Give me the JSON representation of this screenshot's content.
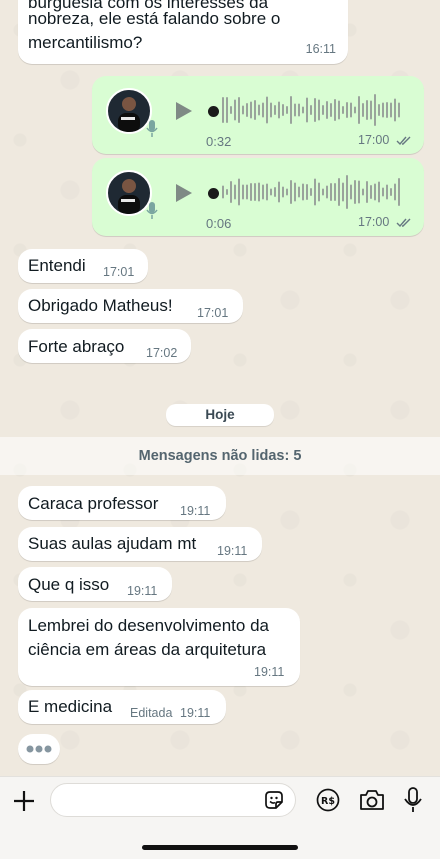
{
  "messages": {
    "m0_line1": "burguesia com os interesses da",
    "m0_line2": "nobreza, ele está falando sobre o",
    "m0_line3": "mercantilismo?",
    "m0_time": "16:11",
    "v1_duration": "0:32",
    "v1_time": "17:00",
    "v2_duration": "0:06",
    "v2_time": "17:00",
    "m1_text": "Entendi",
    "m1_time": "17:01",
    "m2_text": "Obrigado Matheus!",
    "m2_time": "17:01",
    "m3_text": "Forte abraço",
    "m3_time": "17:02",
    "date_pill": "Hoje",
    "unread_banner": "Mensagens não lidas: 5",
    "m4_text": "Caraca professor",
    "m4_time": "19:11",
    "m5_text": "Suas aulas ajudam mt",
    "m5_time": "19:11",
    "m6_text": "Que q isso",
    "m6_time": "19:11",
    "m7_line1": "Lembrei do desenvolvimento da",
    "m7_line2": "ciência em áreas da arquitetura",
    "m7_time": "19:11",
    "m8_text": "E medicina",
    "m8_edited": "Editada",
    "m8_time": "19:11"
  },
  "icons": {
    "add": "plus-icon",
    "sticker": "sticker-icon",
    "payment": "rs-icon",
    "camera": "camera-icon",
    "mic": "mic-icon"
  },
  "colors": {
    "incoming": "#ffffff",
    "outgoing": "#d9fdd3",
    "chat_bg": "#efe9df"
  }
}
